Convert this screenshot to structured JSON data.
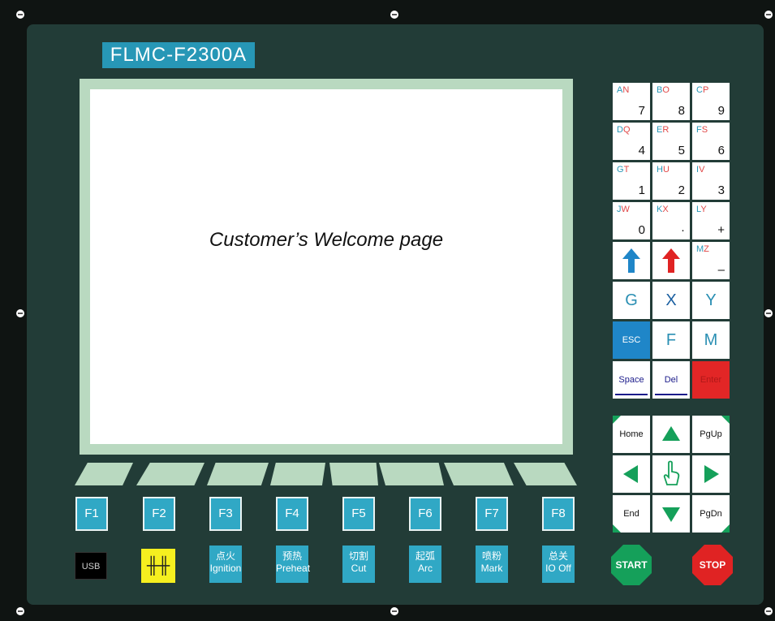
{
  "panel": {
    "model": "FLMC-F2300A",
    "welcome_text": "Customer’s Welcome page"
  },
  "function_keys": [
    "F1",
    "F2",
    "F3",
    "F4",
    "F5",
    "F6",
    "F7",
    "F8"
  ],
  "bottom_keys": {
    "usb": "USB",
    "torch_symbol": "╫╫",
    "ignition_cn": "点火",
    "ignition_en": "Ignition",
    "preheat_cn": "预热",
    "preheat_en": "Preheat",
    "cut_cn": "切割",
    "cut_en": "Cut",
    "arc_cn": "起弧",
    "arc_en": "Arc",
    "mark_cn": "喷粉",
    "mark_en": "Mark",
    "io_off_cn": "总关",
    "io_off_en": "IO Off"
  },
  "keypad": {
    "k7_alpha": [
      "A",
      "N"
    ],
    "k7_num": "7",
    "k8_alpha": [
      "B",
      "O"
    ],
    "k8_num": "8",
    "k9_alpha": [
      "C",
      "P"
    ],
    "k9_num": "9",
    "k4_alpha": [
      "D",
      "Q"
    ],
    "k4_num": "4",
    "k5_alpha": [
      "E",
      "R"
    ],
    "k5_num": "5",
    "k6_alpha": [
      "F",
      "S"
    ],
    "k6_num": "6",
    "k1_alpha": [
      "G",
      "T"
    ],
    "k1_num": "1",
    "k2_alpha": [
      "H",
      "U"
    ],
    "k2_num": "2",
    "k3_alpha": [
      "I",
      "V"
    ],
    "k3_num": "3",
    "k0_alpha": [
      "J",
      "W"
    ],
    "k0_num": "0",
    "kdot_alpha": [
      "K",
      "X"
    ],
    "kdot_num": "·",
    "kplus_alpha": [
      "L",
      "Y"
    ],
    "kplus_num": "+",
    "kminus_alpha": [
      "M",
      "Z"
    ],
    "kminus_num": "–",
    "g": "G",
    "x": "X",
    "y": "Y",
    "esc": "ESC",
    "f": "F",
    "m": "M",
    "space": "Space",
    "del": "Del",
    "enter": "Enter"
  },
  "nav_keys": {
    "home": "Home",
    "pgup": "PgUp",
    "end": "End",
    "pgdn": "PgDn"
  },
  "control": {
    "start": "START",
    "stop": "STOP"
  },
  "colors": {
    "panel": "#223c37",
    "bezel": "#b9d9c0",
    "function_key": "#30a8c5",
    "model_badge": "#2797b6",
    "start": "#15a05a",
    "stop": "#e02323",
    "arrow_green": "#15a05a"
  }
}
